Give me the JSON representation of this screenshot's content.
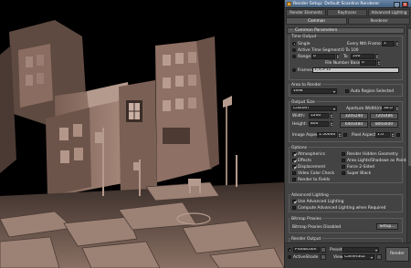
{
  "window": {
    "title": "Render Setup: Default Scanline Renderer",
    "minimize": "_",
    "close": "x"
  },
  "tabs_row1": [
    "Render Elements",
    "Raytracer",
    "Advanced Lighting"
  ],
  "tabs_row2": [
    "Common",
    "Renderer"
  ],
  "common_parameters": {
    "header": "Common Parameters",
    "sign": "-",
    "time_output": {
      "group": "Time Output",
      "single": "Single",
      "every_nth_frame": "Every Nth Frame:",
      "nth_value": "1",
      "active_time_segment": "Active Time Segment:",
      "segment_value": "0 To 100",
      "range": "Range:",
      "range_from": "0",
      "range_to_label": "To",
      "range_to": "100",
      "file_number_base": "File Number Base:",
      "file_number_value": "0",
      "frames": "Frames",
      "frames_value": "1,3,5-12"
    },
    "area_to_render": {
      "group": "Area to Render",
      "value": "View",
      "auto_region": "Auto Region Selected"
    },
    "output_size": {
      "group": "Output Size",
      "preset": "Custom",
      "aperture_label": "Aperture Width(mm):",
      "aperture_value": "36.0",
      "width_label": "Width:",
      "width_value": "1200",
      "height_label": "Height:",
      "height_value": "800",
      "presets": [
        "320x240",
        "720x486",
        "640x480",
        "800x600"
      ],
      "image_aspect_label": "Image Aspect:",
      "image_aspect_value": "1.50000",
      "pixel_aspect_label": "Pixel Aspect:",
      "pixel_aspect_value": "1.0"
    },
    "options": {
      "group": "Options",
      "left": [
        {
          "label": "Atmospherics",
          "on": true
        },
        {
          "label": "Effects",
          "on": true
        },
        {
          "label": "Displacement",
          "on": true
        },
        {
          "label": "Video Color Check",
          "on": false
        },
        {
          "label": "Render to Fields",
          "on": false
        }
      ],
      "right": [
        {
          "label": "Render Hidden Geometry",
          "on": false
        },
        {
          "label": "Area Lights/Shadows as Points",
          "on": false
        },
        {
          "label": "Force 2-Sided",
          "on": false
        },
        {
          "label": "Super Black",
          "on": false
        }
      ]
    },
    "advanced_lighting": {
      "group": "Advanced Lighting",
      "use": "Use Advanced Lighting",
      "compute": "Compute Advanced Lighting when Required"
    },
    "bitmap_proxies": {
      "group": "Bitmap Proxies",
      "status": "Bitmap Proxies Disabled",
      "setup": "Setup..."
    },
    "render_output": "Render Output"
  },
  "bottom_bar": {
    "production": "Production",
    "active_shade": "ActiveShade",
    "preset_label": "Preset:",
    "preset_value": "",
    "view_label": "View:",
    "view_value": "Camera02",
    "render": "Render"
  },
  "colors": {
    "dialog_bg": "#3f3f3f",
    "title_bar": "#44607f",
    "scene_surface": "#8a6a5c"
  }
}
